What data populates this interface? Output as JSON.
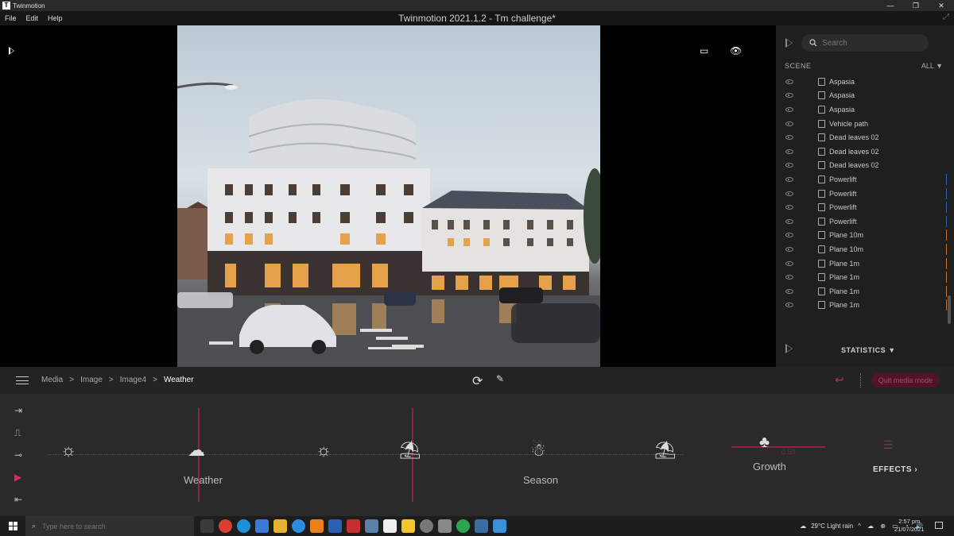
{
  "window": {
    "app_name": "Twinmotion",
    "title": "Twinmotion 2021.1.2 - Tm challenge*",
    "controls": [
      "—",
      "❐",
      "✕"
    ]
  },
  "menu": [
    "File",
    "Edit",
    "Help"
  ],
  "sidebar": {
    "search_placeholder": "Search",
    "scene_label": "SCENE",
    "filter_label": "ALL",
    "items": [
      {
        "label": "Aspasia",
        "icon": "object-icon",
        "mark": ""
      },
      {
        "label": "Aspasia",
        "icon": "object-icon",
        "mark": ""
      },
      {
        "label": "Aspasia",
        "icon": "object-icon",
        "mark": ""
      },
      {
        "label": "Vehicle path",
        "icon": "path-icon",
        "mark": ""
      },
      {
        "label": "Dead leaves 02",
        "icon": "folder-icon",
        "mark": ""
      },
      {
        "label": "Dead leaves 02",
        "icon": "folder-icon",
        "mark": ""
      },
      {
        "label": "Dead leaves 02",
        "icon": "folder-icon",
        "mark": ""
      },
      {
        "label": "Powerlift",
        "icon": "object-icon",
        "mark": "#2f5fa8"
      },
      {
        "label": "Powerlift",
        "icon": "object-icon",
        "mark": "#2f5fa8"
      },
      {
        "label": "Powerlift",
        "icon": "object-icon",
        "mark": "#2f5fa8"
      },
      {
        "label": "Powerlift",
        "icon": "object-icon",
        "mark": "#2f5fa8"
      },
      {
        "label": "Plane 10m",
        "icon": "group-icon",
        "mark": "#c9702c"
      },
      {
        "label": "Plane 10m",
        "icon": "group-icon",
        "mark": "#c9702c"
      },
      {
        "label": "Plane 1m",
        "icon": "group-icon",
        "mark": "#c9702c"
      },
      {
        "label": "Plane 1m",
        "icon": "group-icon",
        "mark": "#c9702c"
      },
      {
        "label": "Plane 1m",
        "icon": "group-icon",
        "mark": "#c9702c"
      },
      {
        "label": "Plane 1m",
        "icon": "group-icon",
        "mark": "#c9702c"
      }
    ],
    "statistics_label": "STATISTICS"
  },
  "breadcrumb": {
    "items": [
      "Media",
      "Image",
      "Image4"
    ],
    "current": "Weather",
    "separator": ">"
  },
  "toolbar": {
    "quit_label": "Quit media mode"
  },
  "weather": {
    "weather_label": "Weather",
    "season_label": "Season",
    "growth_label": "Growth",
    "growth_value": "0.50",
    "effects_label": "EFFECTS",
    "icons": [
      "sun-icon",
      "cloud-icon",
      "sun-icon",
      "beach-icon",
      "snowman-icon",
      "beach-icon",
      "tree-icon"
    ]
  },
  "taskbar": {
    "search_placeholder": "Type here to search",
    "weather_text": "29°C  Light rain",
    "time": "2:57 pm",
    "date": "21/07/2021"
  },
  "colors": {
    "accent": "#8e2247",
    "panel": "#2a2a2a",
    "sidebar": "#1f1f1f"
  }
}
